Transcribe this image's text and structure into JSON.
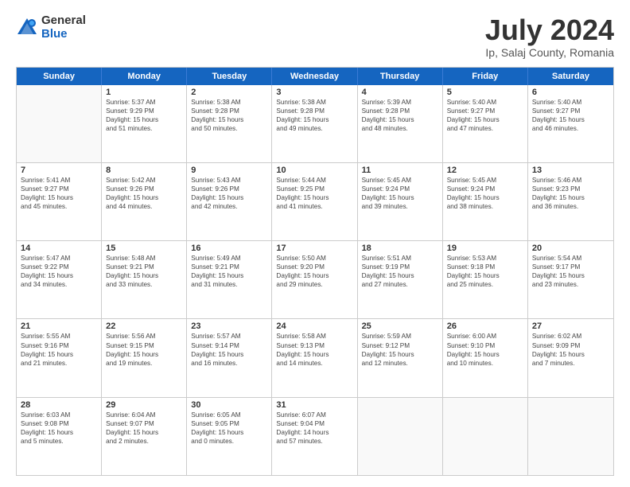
{
  "logo": {
    "general": "General",
    "blue": "Blue"
  },
  "header": {
    "month_year": "July 2024",
    "location": "Ip, Salaj County, Romania"
  },
  "weekdays": [
    "Sunday",
    "Monday",
    "Tuesday",
    "Wednesday",
    "Thursday",
    "Friday",
    "Saturday"
  ],
  "weeks": [
    [
      {
        "day": "",
        "lines": []
      },
      {
        "day": "1",
        "lines": [
          "Sunrise: 5:37 AM",
          "Sunset: 9:29 PM",
          "Daylight: 15 hours",
          "and 51 minutes."
        ]
      },
      {
        "day": "2",
        "lines": [
          "Sunrise: 5:38 AM",
          "Sunset: 9:28 PM",
          "Daylight: 15 hours",
          "and 50 minutes."
        ]
      },
      {
        "day": "3",
        "lines": [
          "Sunrise: 5:38 AM",
          "Sunset: 9:28 PM",
          "Daylight: 15 hours",
          "and 49 minutes."
        ]
      },
      {
        "day": "4",
        "lines": [
          "Sunrise: 5:39 AM",
          "Sunset: 9:28 PM",
          "Daylight: 15 hours",
          "and 48 minutes."
        ]
      },
      {
        "day": "5",
        "lines": [
          "Sunrise: 5:40 AM",
          "Sunset: 9:27 PM",
          "Daylight: 15 hours",
          "and 47 minutes."
        ]
      },
      {
        "day": "6",
        "lines": [
          "Sunrise: 5:40 AM",
          "Sunset: 9:27 PM",
          "Daylight: 15 hours",
          "and 46 minutes."
        ]
      }
    ],
    [
      {
        "day": "7",
        "lines": [
          "Sunrise: 5:41 AM",
          "Sunset: 9:27 PM",
          "Daylight: 15 hours",
          "and 45 minutes."
        ]
      },
      {
        "day": "8",
        "lines": [
          "Sunrise: 5:42 AM",
          "Sunset: 9:26 PM",
          "Daylight: 15 hours",
          "and 44 minutes."
        ]
      },
      {
        "day": "9",
        "lines": [
          "Sunrise: 5:43 AM",
          "Sunset: 9:26 PM",
          "Daylight: 15 hours",
          "and 42 minutes."
        ]
      },
      {
        "day": "10",
        "lines": [
          "Sunrise: 5:44 AM",
          "Sunset: 9:25 PM",
          "Daylight: 15 hours",
          "and 41 minutes."
        ]
      },
      {
        "day": "11",
        "lines": [
          "Sunrise: 5:45 AM",
          "Sunset: 9:24 PM",
          "Daylight: 15 hours",
          "and 39 minutes."
        ]
      },
      {
        "day": "12",
        "lines": [
          "Sunrise: 5:45 AM",
          "Sunset: 9:24 PM",
          "Daylight: 15 hours",
          "and 38 minutes."
        ]
      },
      {
        "day": "13",
        "lines": [
          "Sunrise: 5:46 AM",
          "Sunset: 9:23 PM",
          "Daylight: 15 hours",
          "and 36 minutes."
        ]
      }
    ],
    [
      {
        "day": "14",
        "lines": [
          "Sunrise: 5:47 AM",
          "Sunset: 9:22 PM",
          "Daylight: 15 hours",
          "and 34 minutes."
        ]
      },
      {
        "day": "15",
        "lines": [
          "Sunrise: 5:48 AM",
          "Sunset: 9:21 PM",
          "Daylight: 15 hours",
          "and 33 minutes."
        ]
      },
      {
        "day": "16",
        "lines": [
          "Sunrise: 5:49 AM",
          "Sunset: 9:21 PM",
          "Daylight: 15 hours",
          "and 31 minutes."
        ]
      },
      {
        "day": "17",
        "lines": [
          "Sunrise: 5:50 AM",
          "Sunset: 9:20 PM",
          "Daylight: 15 hours",
          "and 29 minutes."
        ]
      },
      {
        "day": "18",
        "lines": [
          "Sunrise: 5:51 AM",
          "Sunset: 9:19 PM",
          "Daylight: 15 hours",
          "and 27 minutes."
        ]
      },
      {
        "day": "19",
        "lines": [
          "Sunrise: 5:53 AM",
          "Sunset: 9:18 PM",
          "Daylight: 15 hours",
          "and 25 minutes."
        ]
      },
      {
        "day": "20",
        "lines": [
          "Sunrise: 5:54 AM",
          "Sunset: 9:17 PM",
          "Daylight: 15 hours",
          "and 23 minutes."
        ]
      }
    ],
    [
      {
        "day": "21",
        "lines": [
          "Sunrise: 5:55 AM",
          "Sunset: 9:16 PM",
          "Daylight: 15 hours",
          "and 21 minutes."
        ]
      },
      {
        "day": "22",
        "lines": [
          "Sunrise: 5:56 AM",
          "Sunset: 9:15 PM",
          "Daylight: 15 hours",
          "and 19 minutes."
        ]
      },
      {
        "day": "23",
        "lines": [
          "Sunrise: 5:57 AM",
          "Sunset: 9:14 PM",
          "Daylight: 15 hours",
          "and 16 minutes."
        ]
      },
      {
        "day": "24",
        "lines": [
          "Sunrise: 5:58 AM",
          "Sunset: 9:13 PM",
          "Daylight: 15 hours",
          "and 14 minutes."
        ]
      },
      {
        "day": "25",
        "lines": [
          "Sunrise: 5:59 AM",
          "Sunset: 9:12 PM",
          "Daylight: 15 hours",
          "and 12 minutes."
        ]
      },
      {
        "day": "26",
        "lines": [
          "Sunrise: 6:00 AM",
          "Sunset: 9:10 PM",
          "Daylight: 15 hours",
          "and 10 minutes."
        ]
      },
      {
        "day": "27",
        "lines": [
          "Sunrise: 6:02 AM",
          "Sunset: 9:09 PM",
          "Daylight: 15 hours",
          "and 7 minutes."
        ]
      }
    ],
    [
      {
        "day": "28",
        "lines": [
          "Sunrise: 6:03 AM",
          "Sunset: 9:08 PM",
          "Daylight: 15 hours",
          "and 5 minutes."
        ]
      },
      {
        "day": "29",
        "lines": [
          "Sunrise: 6:04 AM",
          "Sunset: 9:07 PM",
          "Daylight: 15 hours",
          "and 2 minutes."
        ]
      },
      {
        "day": "30",
        "lines": [
          "Sunrise: 6:05 AM",
          "Sunset: 9:05 PM",
          "Daylight: 15 hours",
          "and 0 minutes."
        ]
      },
      {
        "day": "31",
        "lines": [
          "Sunrise: 6:07 AM",
          "Sunset: 9:04 PM",
          "Daylight: 14 hours",
          "and 57 minutes."
        ]
      },
      {
        "day": "",
        "lines": []
      },
      {
        "day": "",
        "lines": []
      },
      {
        "day": "",
        "lines": []
      }
    ]
  ]
}
